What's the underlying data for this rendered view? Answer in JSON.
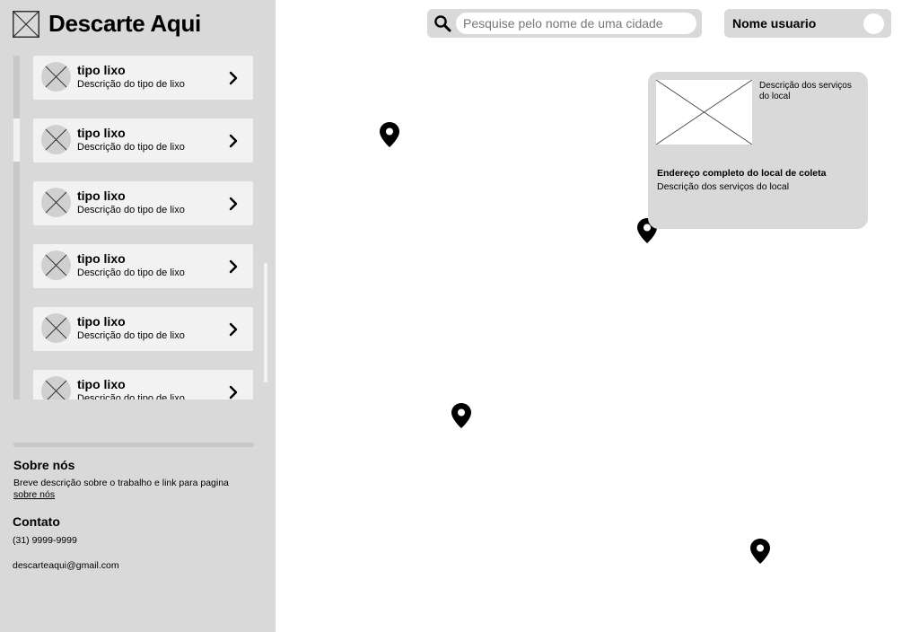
{
  "app": {
    "title": "Descarte Aqui"
  },
  "search": {
    "placeholder": "Pesquise pelo nome de uma cidade"
  },
  "user": {
    "name": "Nome usuario"
  },
  "waste_types": [
    {
      "title": "tipo lixo",
      "description": "Descrição do tipo de lixo"
    },
    {
      "title": "tipo lixo",
      "description": "Descrição do tipo de lixo"
    },
    {
      "title": "tipo lixo",
      "description": "Descrição do tipo de lixo"
    },
    {
      "title": "tipo lixo",
      "description": "Descrição do tipo de lixo"
    },
    {
      "title": "tipo lixo",
      "description": "Descrição do tipo de lixo"
    },
    {
      "title": "tipo lixo",
      "description": "Descrição do tipo de lixo"
    }
  ],
  "about": {
    "title": "Sobre nós",
    "text": "Breve descrição sobre o trabalho e link para pagina",
    "link_label": "sobre nós"
  },
  "contact": {
    "title": "Contato",
    "phone": "(31) 9999-9999",
    "email": "descarteaqui@gmail.com"
  },
  "popup": {
    "services_short": "Descrição dos serviços do local",
    "address": "Endereço completo do local de coleta",
    "services": "Descrição dos serviços do local"
  },
  "icons": {
    "brand": "placeholder-image-icon",
    "search": "search-icon",
    "pin": "map-pin-icon",
    "chevron": "chevron-right-icon"
  },
  "colors": {
    "panel": "#d9d9d9",
    "card": "#f2f2f2",
    "map": "#ffffff",
    "pin": "#000000"
  }
}
